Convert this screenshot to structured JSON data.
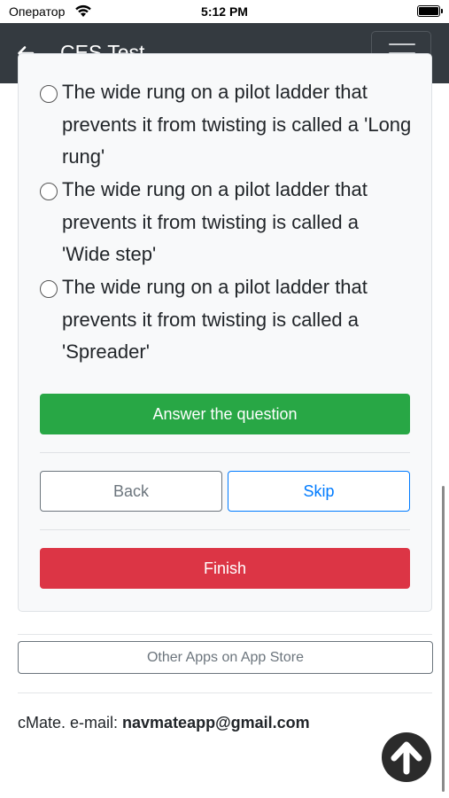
{
  "status_bar": {
    "carrier": "Оператор",
    "time": "5:12 PM"
  },
  "navbar": {
    "title": "CES Test",
    "back_icon": "arrow-left-icon",
    "menu_icon": "hamburger-menu-icon"
  },
  "question": {
    "options": [
      {
        "text": "The wide rung on a pilot ladder that prevents it from twisting is called a 'Long rung'",
        "selected": false
      },
      {
        "text": "The wide rung on a pilot ladder that prevents it from twisting is called a 'Wide step'",
        "selected": false
      },
      {
        "text": "The wide rung on a pilot ladder that prevents it from twisting is called a 'Spreader'",
        "selected": false
      }
    ]
  },
  "buttons": {
    "answer": "Answer the question",
    "back": "Back",
    "skip": "Skip",
    "finish": "Finish",
    "other_apps": "Other Apps on App Store"
  },
  "footer": {
    "prefix": "cMate. e-mail: ",
    "email": "navmateapp@gmail.com"
  },
  "scroll_top_icon": "arrow-up-icon",
  "colors": {
    "navbar": "#343a40",
    "success": "#28a745",
    "danger": "#dc3545",
    "primary": "#007bff",
    "secondary": "#6c757d"
  }
}
